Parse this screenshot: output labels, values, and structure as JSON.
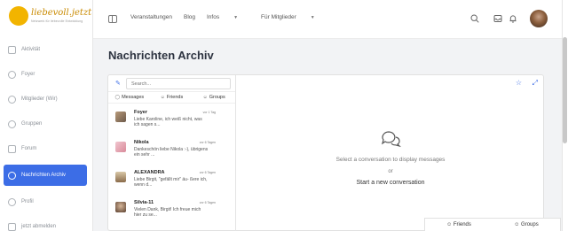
{
  "brand": {
    "logo_text": "liebevoll.jetzt",
    "tagline": "Netzwerk für liebevolle Entwicklung"
  },
  "sidebar": {
    "items": [
      {
        "label": "Aktivität",
        "icon": "activity-icon"
      },
      {
        "label": "Foyer",
        "icon": "foyer-icon"
      },
      {
        "label": "Mitglieder (Wir)",
        "icon": "members-icon"
      },
      {
        "label": "Gruppen",
        "icon": "groups-icon"
      },
      {
        "label": "Forum",
        "icon": "forum-icon"
      },
      {
        "label": "Nachrichten Archiv",
        "icon": "messages-icon",
        "active": true
      },
      {
        "label": "Profil",
        "icon": "profile-icon"
      },
      {
        "label": "jetzt abmelden",
        "icon": "logout-icon"
      }
    ],
    "active_color": "#3c6de6"
  },
  "topbar": {
    "menu": [
      {
        "label": "Veranstaltungen"
      },
      {
        "label": "Blog"
      },
      {
        "label": "Infos",
        "has_dropdown": true
      },
      {
        "label": "Für Mitglieder",
        "has_dropdown": true
      }
    ],
    "icons": [
      "search-icon",
      "inbox-icon",
      "bell-icon"
    ]
  },
  "page": {
    "title": "Nachrichten Archiv"
  },
  "messages": {
    "search_placeholder": "Search...",
    "tabs": [
      {
        "label": "Messages",
        "icon": "chat-icon"
      },
      {
        "label": "Friends",
        "icon": "friends-icon"
      },
      {
        "label": "Groups",
        "icon": "groups-icon"
      }
    ],
    "conversations": [
      {
        "name": "Foyer",
        "time": "vor 1 Tag",
        "preview": "Liebe Karoline, ich weiß nicht, was ich sagen s..."
      },
      {
        "name": "Nikola",
        "time": "vor 6 Tagen",
        "preview": "Dankeschön liebe Nikola :-), übrigens ein sehr ..."
      },
      {
        "name": "ALEXANDRA",
        "time": "vor 6 Tagen",
        "preview": "Liebe Birgit, \"gefällt mir\" äu- ßere ich, wenn d..."
      },
      {
        "name": "Silvia-11",
        "time": "vor 6 Tagen",
        "preview": "Vielen Dank, Birgit! Ich freue mich hier zu se..."
      }
    ],
    "empty_state": "Select a conversation to display messages",
    "or": "or",
    "start_new": "Start a new conversation"
  },
  "bottom_bar": {
    "friends": "Friends",
    "groups": "Groups"
  }
}
